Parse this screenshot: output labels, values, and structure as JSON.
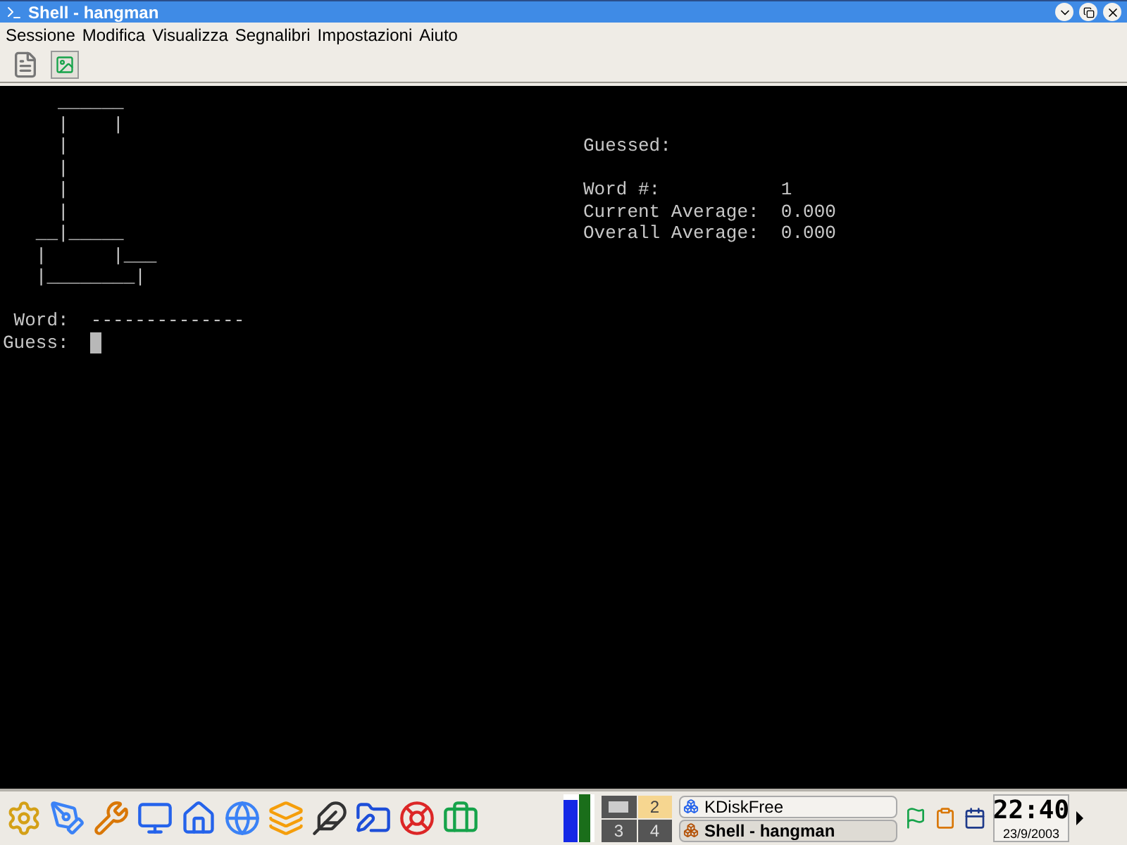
{
  "window": {
    "title": "Shell - hangman"
  },
  "menu": [
    "Sessione",
    "Modifica",
    "Visualizza",
    "Segnalibri",
    "Impostazioni",
    "Aiuto"
  ],
  "terminal": {
    "rows": [
      {
        "left": "     ______"
      },
      {
        "left": "     |    |"
      },
      {
        "left": "     |",
        "right": "Guessed:"
      },
      {
        "left": "     |"
      },
      {
        "left": "     |",
        "right": "Word #:           1"
      },
      {
        "left": "     |",
        "right": "Current Average:  0.000"
      },
      {
        "left": "   __|_____",
        "right": "Overall Average:  0.000"
      },
      {
        "left": "   |      |___"
      },
      {
        "left": "   |________|"
      },
      {},
      {
        "left": " Word:  --------------"
      },
      {
        "left": "Guess:  ",
        "cursor": true
      }
    ]
  },
  "taskbar": {
    "desktops": [
      {
        "kind": "preview",
        "selected": false
      },
      {
        "kind": "number",
        "label": "2",
        "selected": true
      },
      {
        "kind": "number",
        "label": "3",
        "selected": false
      },
      {
        "kind": "number",
        "label": "4",
        "selected": false
      }
    ],
    "tasks": [
      {
        "label": "KDiskFree",
        "active": false
      },
      {
        "label": "Shell - hangman",
        "active": true
      }
    ],
    "clock": {
      "time": "22:40",
      "date": "23/9/2003"
    }
  }
}
